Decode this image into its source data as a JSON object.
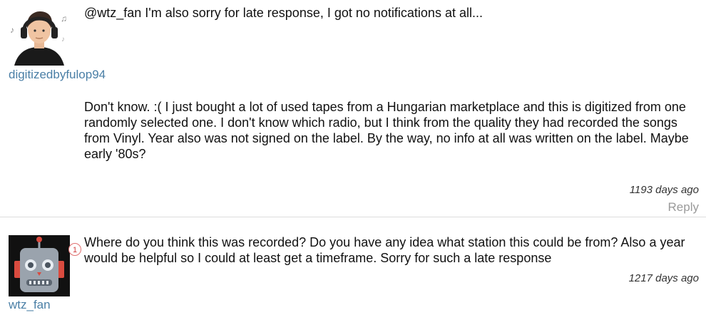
{
  "comments": [
    {
      "username": "digitizedbyfulop94",
      "mention_text": "@wtz_fan I'm also sorry for late response, I got no notifications at all...",
      "body": "Don't know. :( I just bought a lot of used tapes from a Hungarian marketplace and this is digitized from one randomly selected one. I don't know which radio, but I think from the quality they had recorded the songs from Vinyl. Year also was not signed on the label. By the way, no info at all was written on the label. Maybe early '80s?",
      "time": "1193 days ago",
      "reply_label": "Reply",
      "avatar_icon": "headphones-user-avatar"
    },
    {
      "username": "wtz_fan",
      "badge": "1",
      "body": "Where do you think this was recorded? Do you have any idea what station this could be from? Also a year would be helpful so I could at least get a timeframe. Sorry for such a late response",
      "time": "1217 days ago",
      "avatar_icon": "robot-avatar"
    }
  ]
}
